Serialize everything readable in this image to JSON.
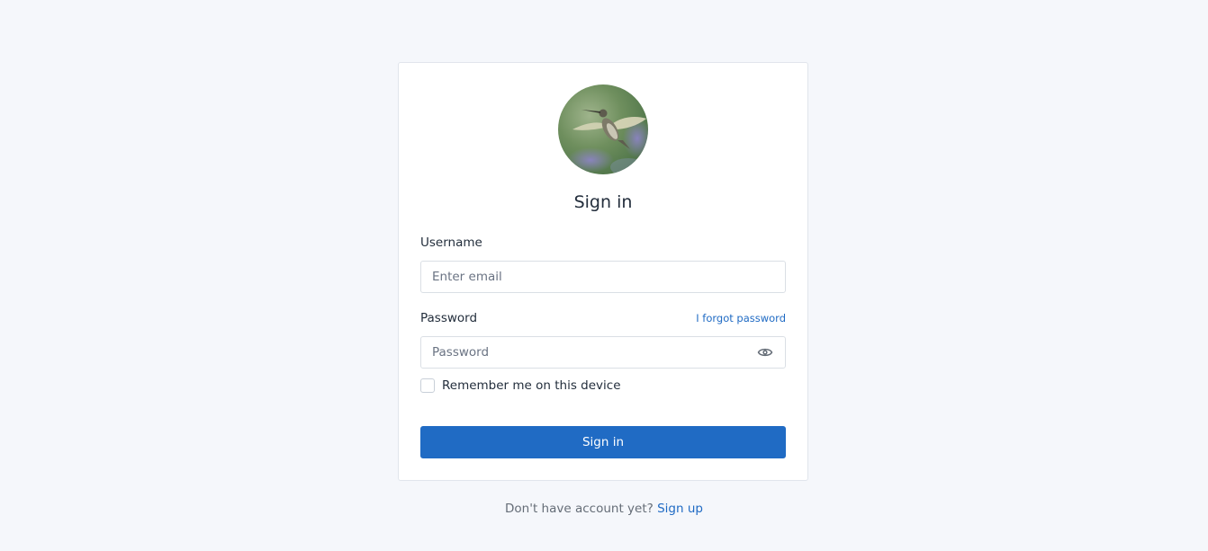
{
  "login": {
    "title": "Sign in",
    "username_label": "Username",
    "username_placeholder": "Enter email",
    "password_label": "Password",
    "forgot_link": "I forgot password",
    "password_placeholder": "Password",
    "remember_label": "Remember me on this device",
    "remember_checked": false,
    "submit_label": "Sign in",
    "avatar_icon": "hummingbird-avatar",
    "password_toggle_icon": "eye-icon"
  },
  "footer": {
    "prompt": "Don't have account yet?",
    "signup_link": "Sign up"
  },
  "colors": {
    "accent": "#206bc4",
    "background": "#f5f7fb",
    "card": "#ffffff"
  }
}
